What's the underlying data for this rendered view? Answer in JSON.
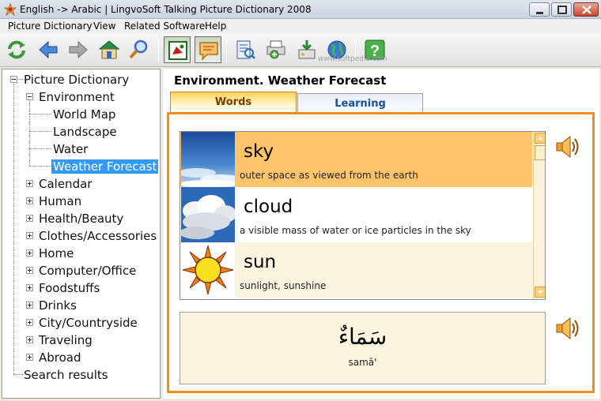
{
  "window": {
    "title": "English -> Arabic | LingvoSoft Talking Picture Dictionary 2008"
  },
  "menu": [
    "Picture Dictionary",
    "View",
    "Related Software",
    "Help"
  ],
  "toolbar": {
    "buttons": [
      "refresh-icon",
      "back-arrow-icon",
      "forward-arrow-icon",
      "home-icon",
      "search-magnifier-icon",
      "picture-mode-icon",
      "speech-bubble-icon",
      "dictionary-book-icon",
      "print-preview-icon",
      "install-icon",
      "web-globe-icon",
      "help-icon"
    ],
    "watermark": "www.softpedia.com"
  },
  "tree": {
    "root": "Picture Dictionary",
    "environment": "Environment",
    "environment_children": [
      "World Map",
      "Landscape",
      "Water",
      "Weather Forecast"
    ],
    "categories": [
      "Calendar",
      "Human",
      "Health/Beauty",
      "Clothes/Accessories",
      "Home",
      "Computer/Office",
      "Foodstuffs",
      "Drinks",
      "City/Countryside",
      "Traveling",
      "Abroad"
    ],
    "search": "Search results",
    "selected": "Weather Forecast"
  },
  "content": {
    "title": "Environment. Weather Forecast",
    "tabs": {
      "words": "Words",
      "learning": "Learning"
    },
    "words": [
      {
        "word": "sky",
        "definition": "outer space as viewed from the earth"
      },
      {
        "word": "cloud",
        "definition": "a visible mass of water or ice particles in the sky"
      },
      {
        "word": "sun",
        "definition": "sunlight, sunshine"
      }
    ],
    "translation": {
      "arabic": "سَمَاءٌ",
      "transliteration": "samā'"
    }
  },
  "colors": {
    "accent_orange": "#f28c1e",
    "selected_row": "#ffc56b",
    "tree_selection": "#3399ff"
  }
}
